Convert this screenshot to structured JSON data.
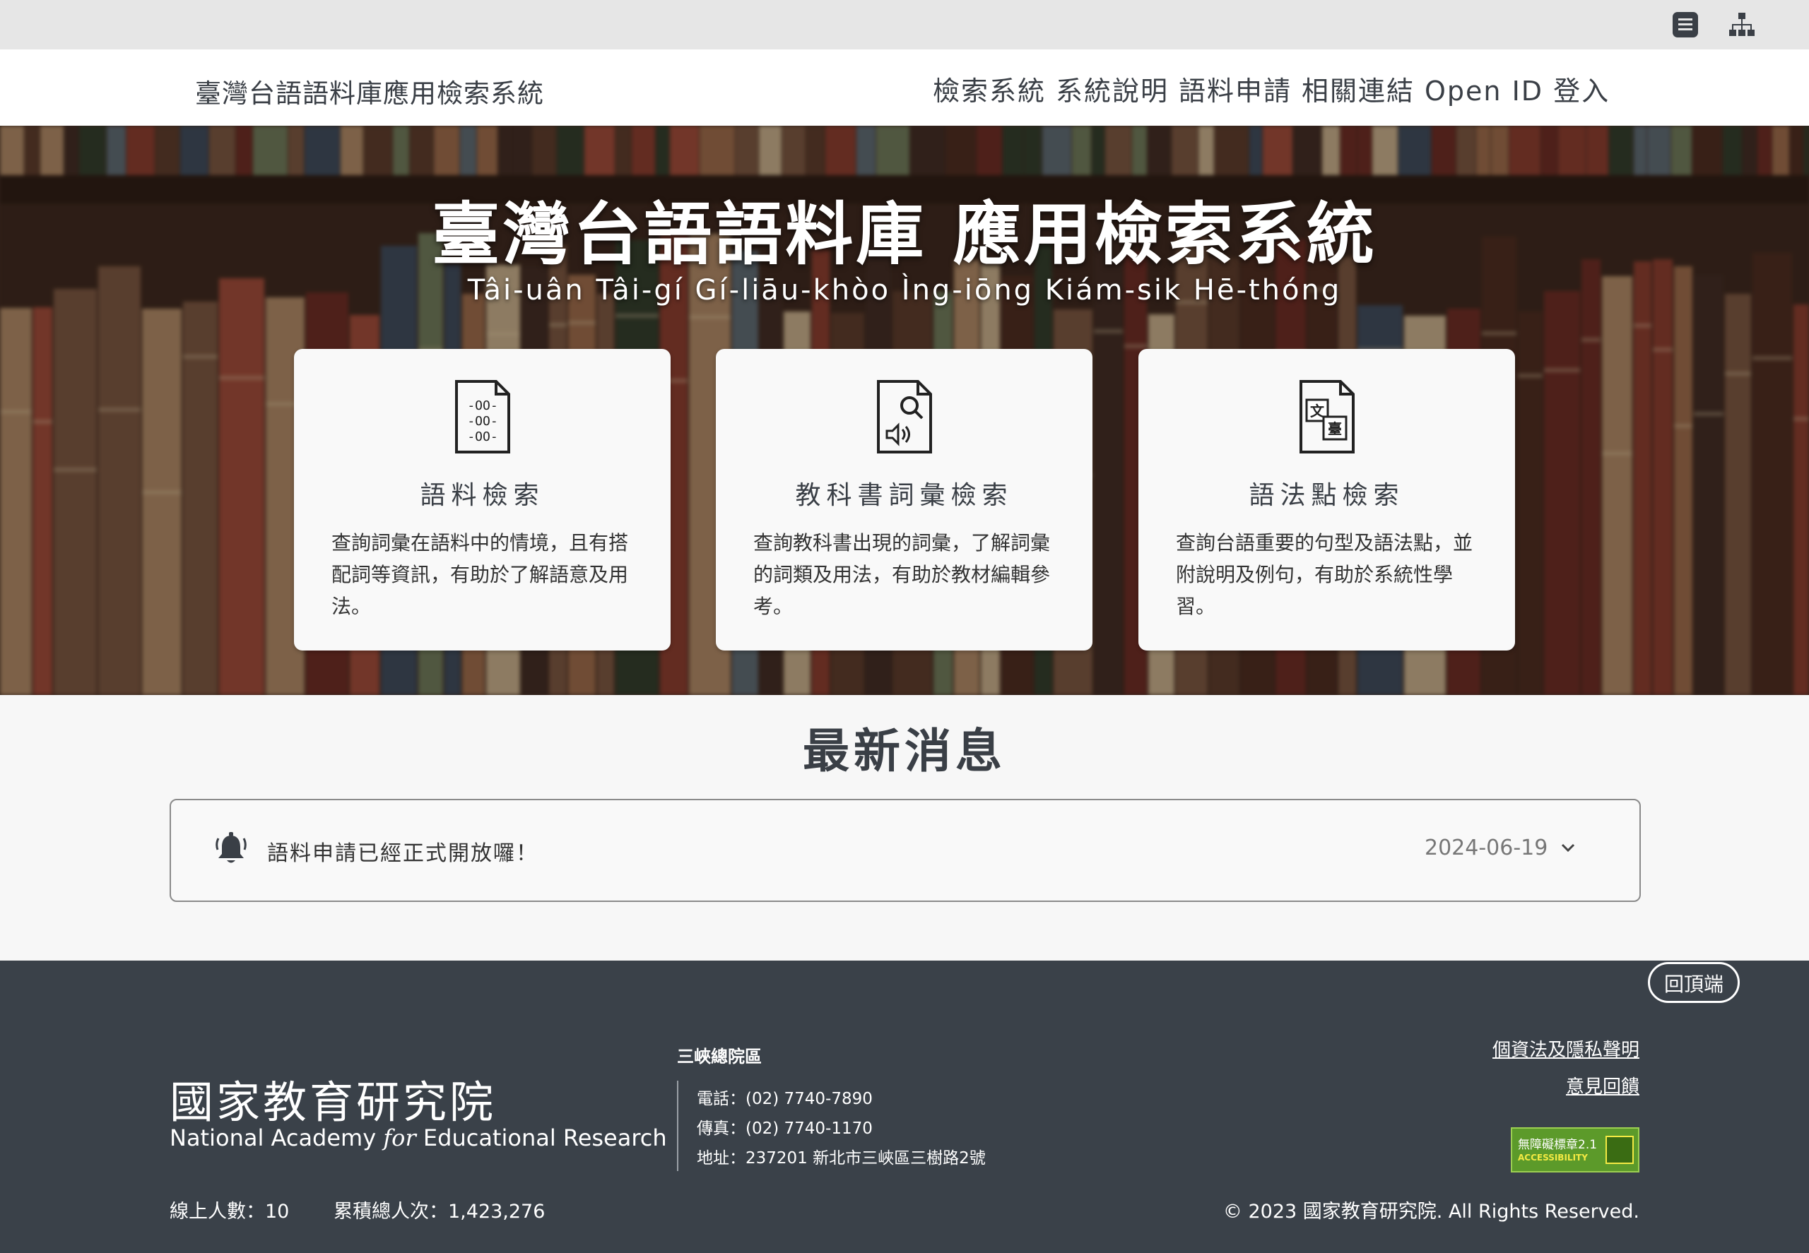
{
  "utility_bar": {
    "icons": [
      "menu-list-icon",
      "sitemap-icon"
    ]
  },
  "header": {
    "site_title": "臺灣台語語料庫應用檢索系統",
    "nav": [
      "檢索系統",
      "系統說明",
      "語料申請",
      "相關連結",
      "Open ID 登入"
    ]
  },
  "hero": {
    "title": "臺灣台語語料庫 應用檢索系統",
    "subtitle": "Tâi-uân Tâi-gí Gí-liāu-khòo Ìng-iōng Kiám-sik Hē-thóng"
  },
  "cards": [
    {
      "title": "語料檢索",
      "description": "查詢詞彙在語料中的情境，且有搭配詞等資訊，有助於了解語意及用法。",
      "icon": "corpus-document-icon"
    },
    {
      "title": "教科書詞彙檢索",
      "description": "查詢教科書出現的詞彙，了解詞彙的詞類及用法，有助於教材編輯參考。",
      "icon": "search-audio-document-icon"
    },
    {
      "title": "語法點檢索",
      "description": "查詢台語重要的句型及語法點，並附說明及例句，有助於系統性學習。",
      "icon": "translate-document-icon"
    }
  ],
  "news": {
    "heading": "最新消息",
    "items": [
      {
        "text": "語料申請已經正式開放囉！",
        "date": "2024-06-19"
      }
    ]
  },
  "footer": {
    "back_to_top": "回頂端",
    "logo_cn": "國家教育研究院",
    "logo_en_pre": "National Academy ",
    "logo_en_for": "for",
    "logo_en_post": " Educational Research",
    "campus": "三峽總院區",
    "phone": "電話：(02) 7740-7890",
    "fax": "傳真：(02) 7740-1170",
    "address": "地址：237201 新北市三峽區三樹路2號",
    "links": [
      "個資法及隱私聲明",
      "意見回饋"
    ],
    "accessibility_badge_top": "無障礙標章2.1",
    "accessibility_badge_bottom": "ACCESSIBILITY",
    "online_users": "線上人數：10",
    "total_visits": "累積總人次：1,423,276",
    "copyright": "© 2023 國家教育研究院. All Rights Reserved."
  },
  "colors": {
    "utility_bar": "#e6e6e6",
    "footer": "#3a4149",
    "text_dark": "#3a3f46",
    "accessibility_green": "#5c9a2a"
  }
}
